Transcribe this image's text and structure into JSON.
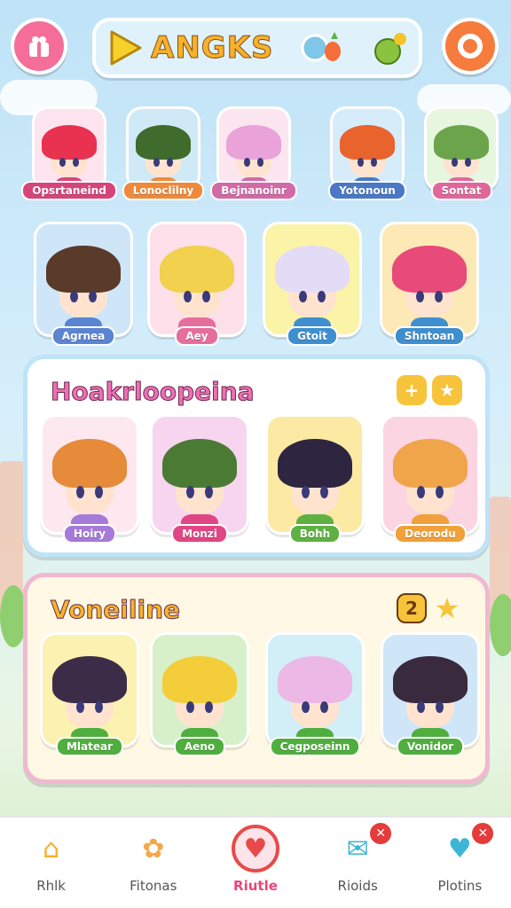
{
  "header": {
    "logo_text": "ANGKS",
    "colors": {
      "left_button": "#f56e9a",
      "right_button": "#f57c3d",
      "logo": "#f6b22b"
    }
  },
  "row1": [
    {
      "label": "Opsrtaneind",
      "label_color": "#d6457a",
      "tile": "#fde4ee",
      "hair": "#e8324f"
    },
    {
      "label": "Lonoclilny",
      "label_color": "#f08a3b",
      "tile": "#cfeaf6",
      "hair": "#3f6b2c"
    },
    {
      "label": "Bejnanoinr",
      "label_color": "#d26aa8",
      "tile": "#fbe6f0",
      "hair": "#e9a3d8"
    },
    {
      "label": "Yotonoun",
      "label_color": "#4a78c7",
      "tile": "#d7ecfa",
      "hair": "#e8642c"
    },
    {
      "label": "Sontat",
      "label_color": "#e0679a",
      "tile": "#e7f6df",
      "hair": "#6ba44a"
    }
  ],
  "row2": [
    {
      "label": "Agrnea",
      "label_color": "#5b84d1",
      "tile": "#cfe6f8",
      "hair": "#5a3a28"
    },
    {
      "label": "Aey",
      "label_color": "#e66e9c",
      "tile": "#fde0ea",
      "hair": "#f2d14e"
    },
    {
      "label": "Gtoit",
      "label_color": "#3f8fcf",
      "tile": "#fbf3a7",
      "hair": "#e4dcf6"
    },
    {
      "label": "Shntoan",
      "label_color": "#3f8fcf",
      "tile": "#fde9b6",
      "hair": "#e84a79"
    }
  ],
  "panel1": {
    "title": "Hoakrloopeina",
    "title_color": "#ee6fb3",
    "icons": [
      "plus-icon",
      "star-icon"
    ],
    "chars": [
      {
        "label": "Hoiry",
        "label_color": "#a67ad8",
        "tile": "#fde8f0",
        "hair": "#e58b3a"
      },
      {
        "label": "Monzi",
        "label_color": "#e04684",
        "tile": "#f7d5ef",
        "hair": "#4b7a35"
      },
      {
        "label": "Bohh",
        "label_color": "#5fb043",
        "tile": "#fbe9a4",
        "hair": "#2e2540"
      },
      {
        "label": "Deorodu",
        "label_color": "#f0a13b",
        "tile": "#fcd5e3",
        "hair": "#f0a54a"
      }
    ]
  },
  "panel2": {
    "title": "Voneiline",
    "title_color": "#f4b52a",
    "icons": [
      "2",
      "star-icon"
    ],
    "chars": [
      {
        "label": "Mlatear",
        "label_color": "#4fae3e",
        "tile": "#fbf1b0",
        "hair": "#3d2c48"
      },
      {
        "label": "Aeno",
        "label_color": "#4fae3e",
        "tile": "#d7f0c9",
        "hair": "#f3ce3a"
      },
      {
        "label": "Cegposeinn",
        "label_color": "#4fae3e",
        "tile": "#d2eef7",
        "hair": "#ecb8e6"
      },
      {
        "label": "Vonidor",
        "label_color": "#4fae3e",
        "tile": "#cfe6f8",
        "hair": "#3a2a3d"
      }
    ]
  },
  "nav": [
    {
      "label": "Rhlk",
      "icon": "house-icon",
      "color": "#f6b22b"
    },
    {
      "label": "Fitonas",
      "icon": "mascot-icon",
      "color": "#f6a64a"
    },
    {
      "label": "Riutle",
      "icon": "heart-icon",
      "color": "#e84a4a",
      "active": true
    },
    {
      "label": "Rioids",
      "icon": "chat-icon",
      "color": "#3fb5d6",
      "badge": true
    },
    {
      "label": "Plotins",
      "icon": "shield-icon",
      "color": "#3fb5d6",
      "badge": true
    }
  ]
}
